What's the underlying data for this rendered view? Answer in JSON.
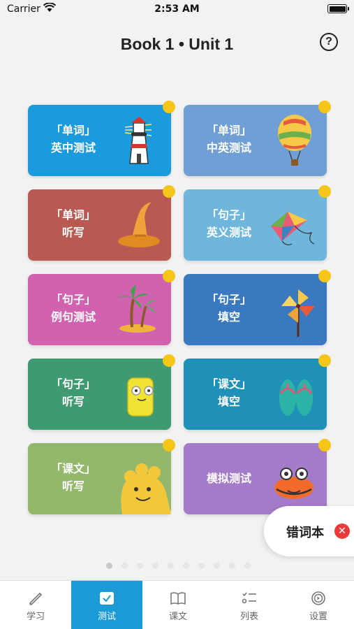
{
  "status": {
    "carrier": "Carrier",
    "time": "2:53 AM"
  },
  "header": {
    "title": "Book 1 • Unit 1",
    "help": "?"
  },
  "cards": [
    {
      "line1": "「单词」",
      "line2": "英中测试",
      "color": "#1b9ade",
      "icon": "lighthouse-icon"
    },
    {
      "line1": "「单词」",
      "line2": "中英测试",
      "color": "#6f9fd4",
      "icon": "hot-air-balloon-icon"
    },
    {
      "line1": "「单词」",
      "line2": "听写",
      "color": "#b85a51",
      "icon": "witch-hat-icon"
    },
    {
      "line1": "「句子」",
      "line2": "英义测试",
      "color": "#6fb6dd",
      "icon": "kite-icon"
    },
    {
      "line1": "「句子」",
      "line2": "例句测试",
      "color": "#d062b0",
      "icon": "palm-island-icon"
    },
    {
      "line1": "「句子」",
      "line2": "填空",
      "color": "#3a79c0",
      "icon": "pinwheel-icon"
    },
    {
      "line1": "「句子」",
      "line2": "听写",
      "color": "#3f9a72",
      "icon": "sponge-icon"
    },
    {
      "line1": "「课文」",
      "line2": "填空",
      "color": "#1f91b9",
      "icon": "flip-flops-icon"
    },
    {
      "line1": "「课文」",
      "line2": "听写",
      "color": "#93b86c",
      "icon": "paw-icon"
    },
    {
      "line1": "模拟测试",
      "line2": "",
      "color": "#a47bc8",
      "icon": "crab-icon"
    }
  ],
  "wrong_book": {
    "label": "错词本",
    "close": "✕"
  },
  "tabs": [
    {
      "label": "学习",
      "icon": "pencil-icon"
    },
    {
      "label": "测试",
      "icon": "checkbox-icon"
    },
    {
      "label": "课文",
      "icon": "book-icon"
    },
    {
      "label": "列表",
      "icon": "list-icon"
    },
    {
      "label": "设置",
      "icon": "play-circle-icon"
    }
  ],
  "colors": {
    "accent": "#1a9ad6",
    "badge": "#f5c518",
    "close": "#e93b3b"
  }
}
